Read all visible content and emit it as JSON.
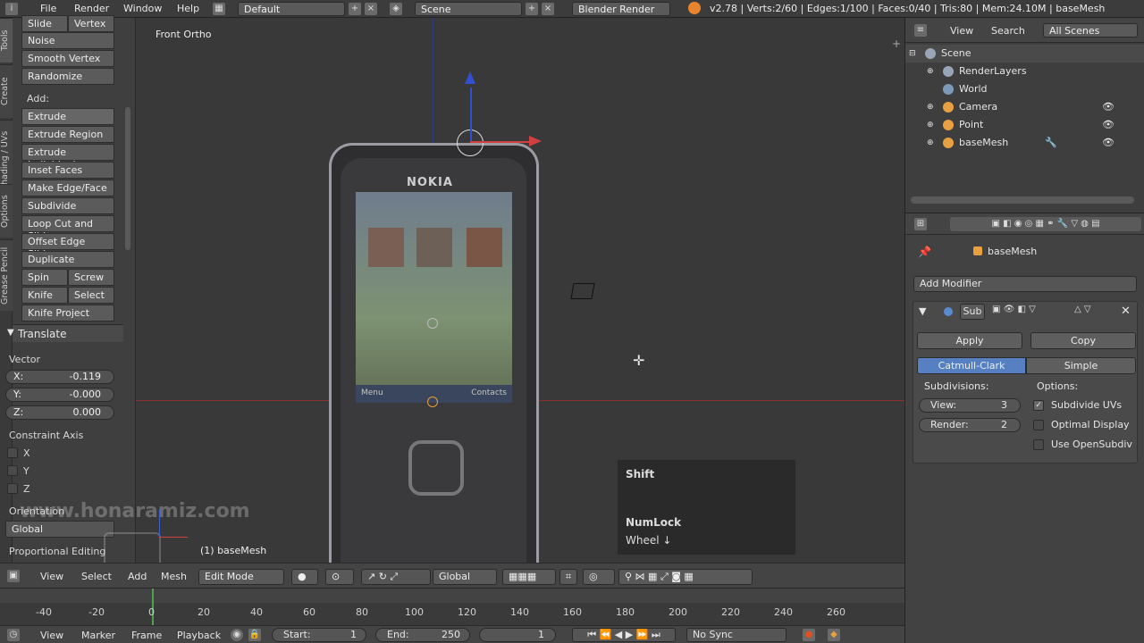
{
  "topbar": {
    "menus": [
      "File",
      "Render",
      "Window",
      "Help"
    ],
    "screen_layout": "Default",
    "scene": "Scene",
    "render_engine": "Blender Render",
    "stats": "v2.78 | Verts:2/60 | Edges:1/100 | Faces:0/40 | Tris:80 | Mem:24.10M | baseMesh"
  },
  "tabs": [
    "Tools",
    "Create",
    "Shading / UVs",
    "Options",
    "Grease Pencil"
  ],
  "toolshelf": {
    "top_items": [
      "Slide Ed",
      "Vertex",
      "Noise",
      "Smooth Vertex",
      "Randomize"
    ],
    "add_label": "Add:",
    "add_items": [
      "Extrude",
      "Extrude Region",
      "Extrude Individual",
      "Inset Faces",
      "Make Edge/Face",
      "Subdivide",
      "Loop Cut and Slide",
      "Offset Edge Slide",
      "Duplicate"
    ],
    "spin": "Spin",
    "screw": "Screw",
    "knife": "Knife",
    "select": "Select",
    "knife_project": "Knife Project",
    "translate": "Translate",
    "vector": "Vector",
    "x_label": "X:",
    "x_val": "-0.119",
    "y_label": "Y:",
    "y_val": "-0.000",
    "z_label": "Z:",
    "z_val": "0.000",
    "constraint_axis": "Constraint Axis",
    "cx": "X",
    "cy": "Y",
    "cz": "Z",
    "orientation": "Orientation",
    "orientation_val": "Global",
    "proportional": "Proportional Editing"
  },
  "viewport": {
    "view_name": "Front Ortho",
    "object_label": "(1) baseMesh",
    "watermark": "www.honaramiz.com",
    "phone_brand": "NOKIA",
    "phone_menu_left": "Menu",
    "phone_menu_right": "Contacts"
  },
  "key_overlay": {
    "line1": "Shift",
    "line2": "NumLock",
    "line3": "Wheel ↓"
  },
  "vpheader": {
    "view": "View",
    "select": "Select",
    "add": "Add",
    "mesh": "Mesh",
    "mode": "Edit Mode",
    "orientation": "Global"
  },
  "timeline": {
    "ticks": [
      "-40",
      "-20",
      "0",
      "20",
      "40",
      "60",
      "80",
      "100",
      "120",
      "140",
      "160",
      "180",
      "200",
      "220",
      "240",
      "260"
    ],
    "current_frame": 1
  },
  "tlheader": {
    "view": "View",
    "marker": "Marker",
    "frame": "Frame",
    "playback": "Playback",
    "start_label": "Start:",
    "start_val": "1",
    "end_label": "End:",
    "end_val": "250",
    "current": "1",
    "sync": "No Sync"
  },
  "outliner": {
    "view": "View",
    "search": "Search",
    "filter": "All Scenes",
    "items": [
      {
        "name": "Scene",
        "icon_color": "#9aa6b8"
      },
      {
        "name": "RenderLayers",
        "icon_color": "#9aa6b8"
      },
      {
        "name": "World",
        "icon_color": "#7f9ab8"
      },
      {
        "name": "Camera",
        "icon_color": "#e8a040"
      },
      {
        "name": "Point",
        "icon_color": "#e8a040"
      },
      {
        "name": "baseMesh",
        "icon_color": "#e8a040"
      }
    ]
  },
  "props": {
    "object_name": "baseMesh",
    "add_modifier": "Add Modifier",
    "mod_name": "Sub",
    "apply": "Apply",
    "copy": "Copy",
    "catmull": "Catmull-Clark",
    "simple": "Simple",
    "subdivisions": "Subdivisions:",
    "view_label": "View:",
    "view_val": "3",
    "render_label": "Render:",
    "render_val": "2",
    "options": "Options:",
    "opt1": "Subdivide UVs",
    "opt2": "Optimal Display",
    "opt3": "Use OpenSubdiv"
  },
  "colors": {
    "accent_blue": "#5680c2",
    "selected_orange": "#f0a030",
    "axis_red": "#d04040",
    "axis_green": "#40b040"
  }
}
